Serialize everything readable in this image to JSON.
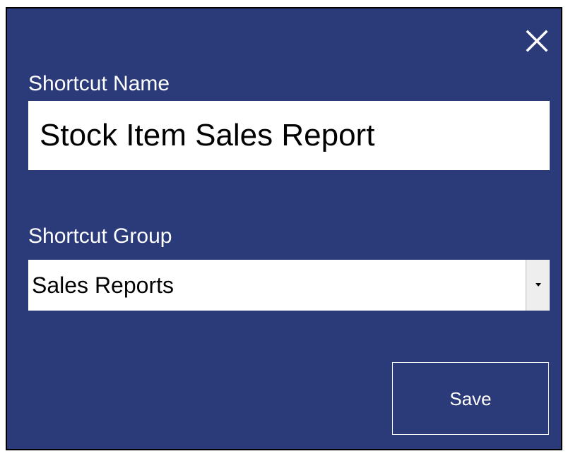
{
  "dialog": {
    "close_icon": "close-icon",
    "background_color": "#2b3a78"
  },
  "shortcut_name": {
    "label": "Shortcut Name",
    "value": "Stock Item Sales Report"
  },
  "shortcut_group": {
    "label": "Shortcut Group",
    "selected": "Sales Reports",
    "dropdown_icon": "chevron-down-icon"
  },
  "actions": {
    "save_label": "Save"
  }
}
